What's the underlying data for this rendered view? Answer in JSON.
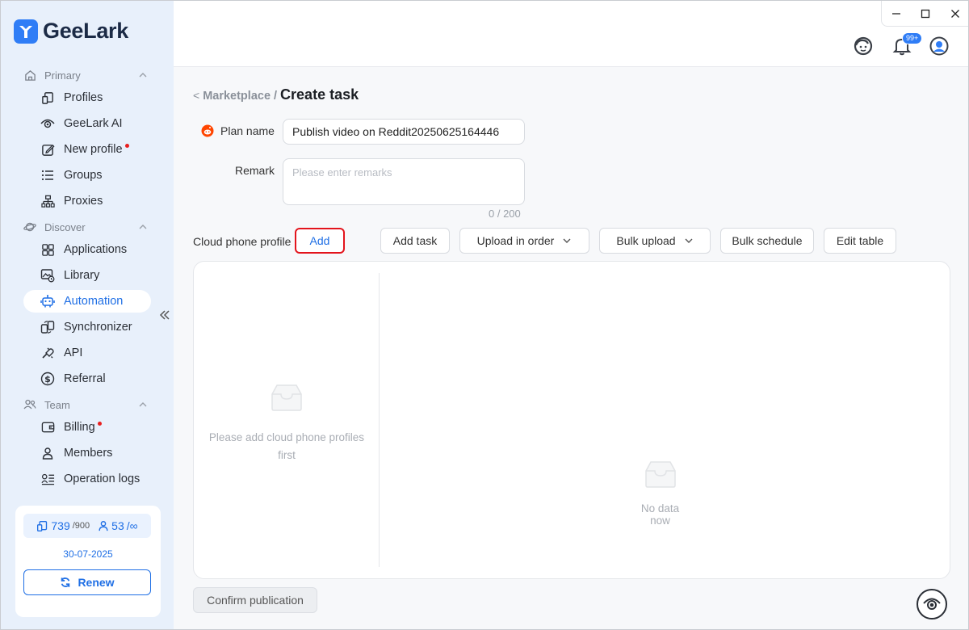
{
  "app": {
    "brand": "GeeLark",
    "brand_color": "#2f7df6",
    "accent_color": "#1f6fe5"
  },
  "sidebar": {
    "sections": [
      {
        "label": "Primary",
        "icon": "home-icon",
        "items": [
          {
            "label": "Profiles",
            "icon": "profiles-icon"
          },
          {
            "label": "GeeLark AI",
            "icon": "eye-icon"
          },
          {
            "label": "New profile",
            "icon": "edit-icon",
            "has_dot": true
          },
          {
            "label": "Groups",
            "icon": "list-icon"
          },
          {
            "label": "Proxies",
            "icon": "network-icon"
          }
        ]
      },
      {
        "label": "Discover",
        "icon": "planet-icon",
        "items": [
          {
            "label": "Applications",
            "icon": "apps-grid-icon"
          },
          {
            "label": "Library",
            "icon": "library-icon"
          },
          {
            "label": "Automation",
            "icon": "robot-icon",
            "active": true
          },
          {
            "label": "Synchronizer",
            "icon": "sync-icon"
          },
          {
            "label": "API",
            "icon": "api-icon"
          },
          {
            "label": "Referral",
            "icon": "dollar-icon"
          }
        ]
      },
      {
        "label": "Team",
        "icon": "team-icon",
        "items": [
          {
            "label": "Billing",
            "icon": "wallet-icon",
            "has_dot": true
          },
          {
            "label": "Members",
            "icon": "person-icon"
          },
          {
            "label": "Operation logs",
            "icon": "log-icon"
          }
        ]
      }
    ],
    "quota": {
      "profiles_used": "739",
      "profiles_total": "/900",
      "members_used": "53",
      "members_total": "/∞",
      "expiry_date": "30-07-2025",
      "renew_label": "Renew"
    }
  },
  "topbar": {
    "notification_badge": "99+",
    "window_controls": [
      "minimize",
      "maximize",
      "close"
    ]
  },
  "main": {
    "breadcrumb": {
      "back": "<",
      "parent": "Marketplace",
      "separator": "/",
      "current": "Create task"
    },
    "form": {
      "plan_name_label": "Plan name",
      "plan_name_value": "Publish video on Reddit20250625164446",
      "remark_label": "Remark",
      "remark_placeholder": "Please enter remarks",
      "remark_count": "0 / 200"
    },
    "toolbar": {
      "cloud_phone_label": "Cloud phone profile",
      "add_label": "Add",
      "add_task_label": "Add task",
      "upload_in_order_label": "Upload in order",
      "bulk_upload_label": "Bulk upload",
      "bulk_schedule_label": "Bulk schedule",
      "edit_table_label": "Edit table"
    },
    "panel": {
      "left_empty_text": "Please add cloud phone profiles first",
      "right_empty_text": "No data now"
    },
    "confirm_label": "Confirm publication"
  }
}
